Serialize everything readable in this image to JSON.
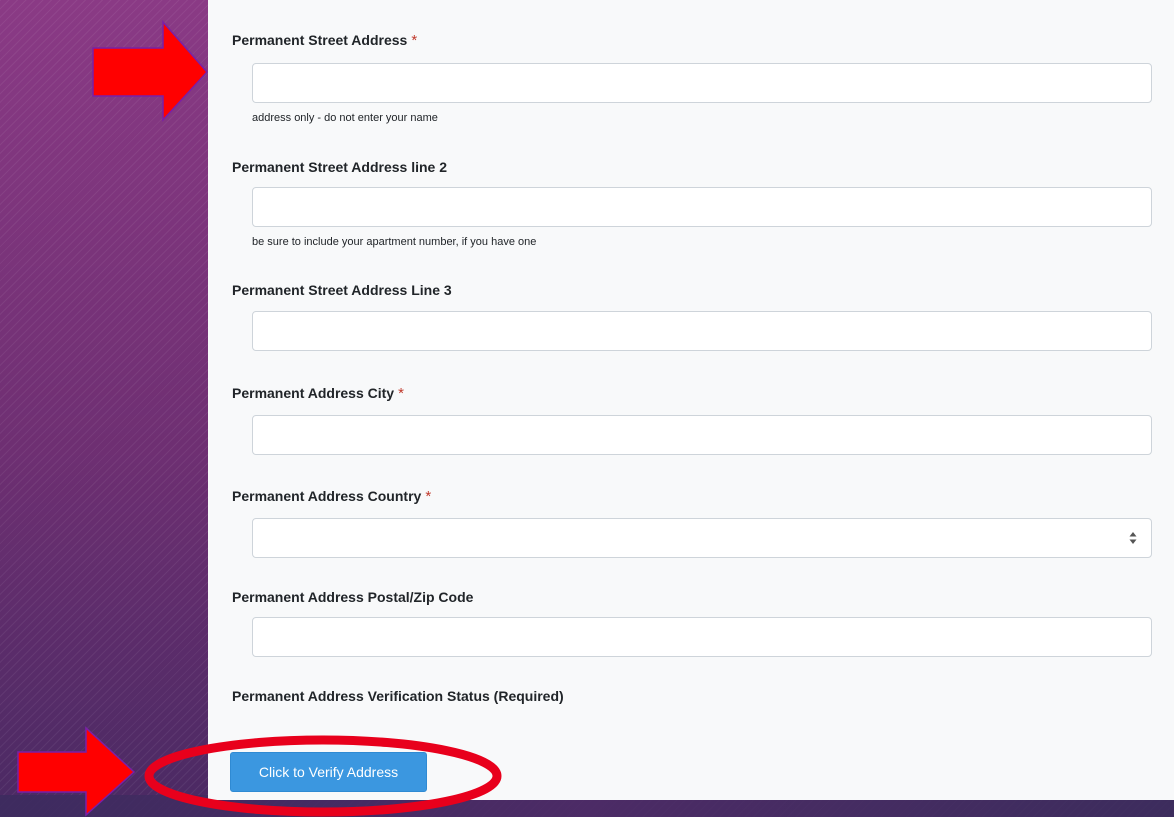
{
  "form": {
    "street1": {
      "label": "Permanent Street Address",
      "required_mark": "*",
      "value": "",
      "help": "address only - do not enter your name"
    },
    "street2": {
      "label": "Permanent Street Address line 2",
      "value": "",
      "help": "be sure to include your apartment number, if you have one"
    },
    "street3": {
      "label": "Permanent Street Address Line 3",
      "value": ""
    },
    "city": {
      "label": "Permanent Address City",
      "required_mark": "*",
      "value": ""
    },
    "country": {
      "label": "Permanent Address Country",
      "required_mark": "*",
      "selected": ""
    },
    "postal": {
      "label": "Permanent Address Postal/Zip Code",
      "value": ""
    },
    "verification": {
      "label": "Permanent Address Verification Status (Required)",
      "button_label": "Click to Verify Address"
    }
  },
  "annotations": {
    "arrow_icon": "arrow-right-icon",
    "highlight_icon": "circle-highlight-icon",
    "arrow_color": "#ff0000",
    "arrow_outline_color": "#7a1fa8",
    "highlight_color": "#e8001c"
  },
  "theme": {
    "background": "#7a3478",
    "panel": "#f8f9fa",
    "button": "#3b97e0",
    "required": "#c0392b"
  }
}
